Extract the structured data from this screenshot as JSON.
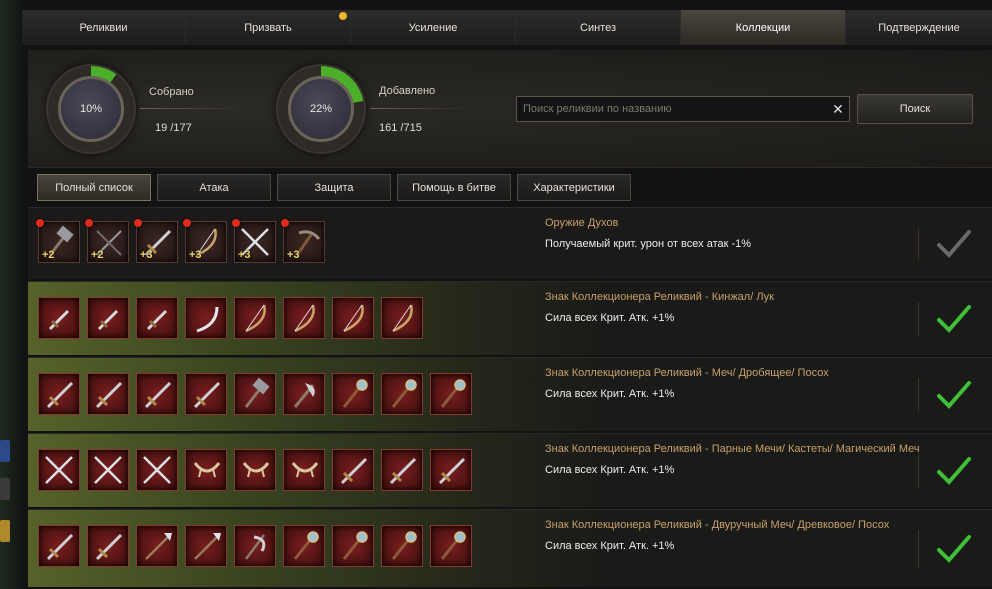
{
  "tabs": [
    {
      "label": "Реликвии",
      "active": false,
      "dot": false
    },
    {
      "label": "Призвать",
      "active": false,
      "dot": true
    },
    {
      "label": "Усиление",
      "active": false,
      "dot": false
    },
    {
      "label": "Синтез",
      "active": false,
      "dot": false
    },
    {
      "label": "Коллекции",
      "active": true,
      "dot": false
    },
    {
      "label": "Подтверждение",
      "active": false,
      "dot": false
    }
  ],
  "stats": {
    "collected": {
      "label": "Собрано",
      "percent": "10%",
      "fraction": 0.1,
      "current": "19",
      "total": "/177"
    },
    "added": {
      "label": "Добавлено",
      "percent": "22%",
      "fraction": 0.22,
      "current": "161",
      "total": "/715"
    }
  },
  "search": {
    "placeholder": "Поиск реликвии по названию",
    "clear_icon": "close-icon",
    "button_label": "Поиск"
  },
  "filters": [
    {
      "label": "Полный список",
      "active": true
    },
    {
      "label": "Атака",
      "active": false
    },
    {
      "label": "Защита",
      "active": false
    },
    {
      "label": "Помощь в битве",
      "active": false
    },
    {
      "label": "Характеристики",
      "active": false
    }
  ],
  "collections": [
    {
      "title": "Оружие Духов",
      "effect": "Получаемый крит. урон от всех атак -1%",
      "completed": false,
      "items": [
        {
          "icon": "hammer-icon",
          "level": "+2"
        },
        {
          "icon": "crossbow-icon",
          "level": "+2"
        },
        {
          "icon": "sword-icon",
          "level": "+3"
        },
        {
          "icon": "bow-icon",
          "level": "+3"
        },
        {
          "icon": "crossed-swords-icon",
          "level": "+3"
        },
        {
          "icon": "pickaxe-icon",
          "level": "+3"
        }
      ]
    },
    {
      "title": "Знак Коллекционера Реликвий - Кинжал/ Лук",
      "effect": "Сила всех Крит. Атк. +1%",
      "completed": true,
      "items": [
        {
          "icon": "dagger-icon"
        },
        {
          "icon": "dagger-icon"
        },
        {
          "icon": "dagger-icon"
        },
        {
          "icon": "scimitar-icon"
        },
        {
          "icon": "bow-icon"
        },
        {
          "icon": "bow-icon"
        },
        {
          "icon": "bow-icon"
        },
        {
          "icon": "bow-icon"
        }
      ]
    },
    {
      "title": "Знак Коллекционера Реликвий - Меч/ Дробящее/ Посох",
      "effect": "Сила всех Крит. Атк. +1%",
      "completed": true,
      "items": [
        {
          "icon": "sword-icon"
        },
        {
          "icon": "sword-icon"
        },
        {
          "icon": "sword-icon"
        },
        {
          "icon": "sword-icon"
        },
        {
          "icon": "hammer-icon"
        },
        {
          "icon": "axe-icon"
        },
        {
          "icon": "staff-icon"
        },
        {
          "icon": "staff-icon"
        },
        {
          "icon": "staff-icon"
        }
      ]
    },
    {
      "title": "Знак Коллекционера Реликвий - Парные Мечи/ Кастеты/ Магический Меч",
      "effect": "Сила всех Крит. Атк. +1%",
      "completed": true,
      "items": [
        {
          "icon": "crossed-swords-icon"
        },
        {
          "icon": "crossed-swords-icon"
        },
        {
          "icon": "crossed-swords-icon"
        },
        {
          "icon": "claw-icon"
        },
        {
          "icon": "claw-icon"
        },
        {
          "icon": "claw-icon"
        },
        {
          "icon": "sword-icon"
        },
        {
          "icon": "sword-icon"
        },
        {
          "icon": "sword-icon"
        }
      ]
    },
    {
      "title": "Знак Коллекционера Реликвий - Двуручный Меч/ Древковое/ Посох",
      "effect": "Сила всех Крит. Атк. +1%",
      "completed": true,
      "items": [
        {
          "icon": "sword-icon"
        },
        {
          "icon": "sword-icon"
        },
        {
          "icon": "spear-icon"
        },
        {
          "icon": "spear-icon"
        },
        {
          "icon": "halberd-icon"
        },
        {
          "icon": "staff-icon"
        },
        {
          "icon": "staff-icon"
        },
        {
          "icon": "staff-icon"
        },
        {
          "icon": "staff-icon"
        }
      ]
    }
  ],
  "colors": {
    "completed_check": "#3fbf3a",
    "incomplete_check": "#6a6a6a",
    "progress": "#4caf2a",
    "collection_title": "#c8a06a"
  }
}
